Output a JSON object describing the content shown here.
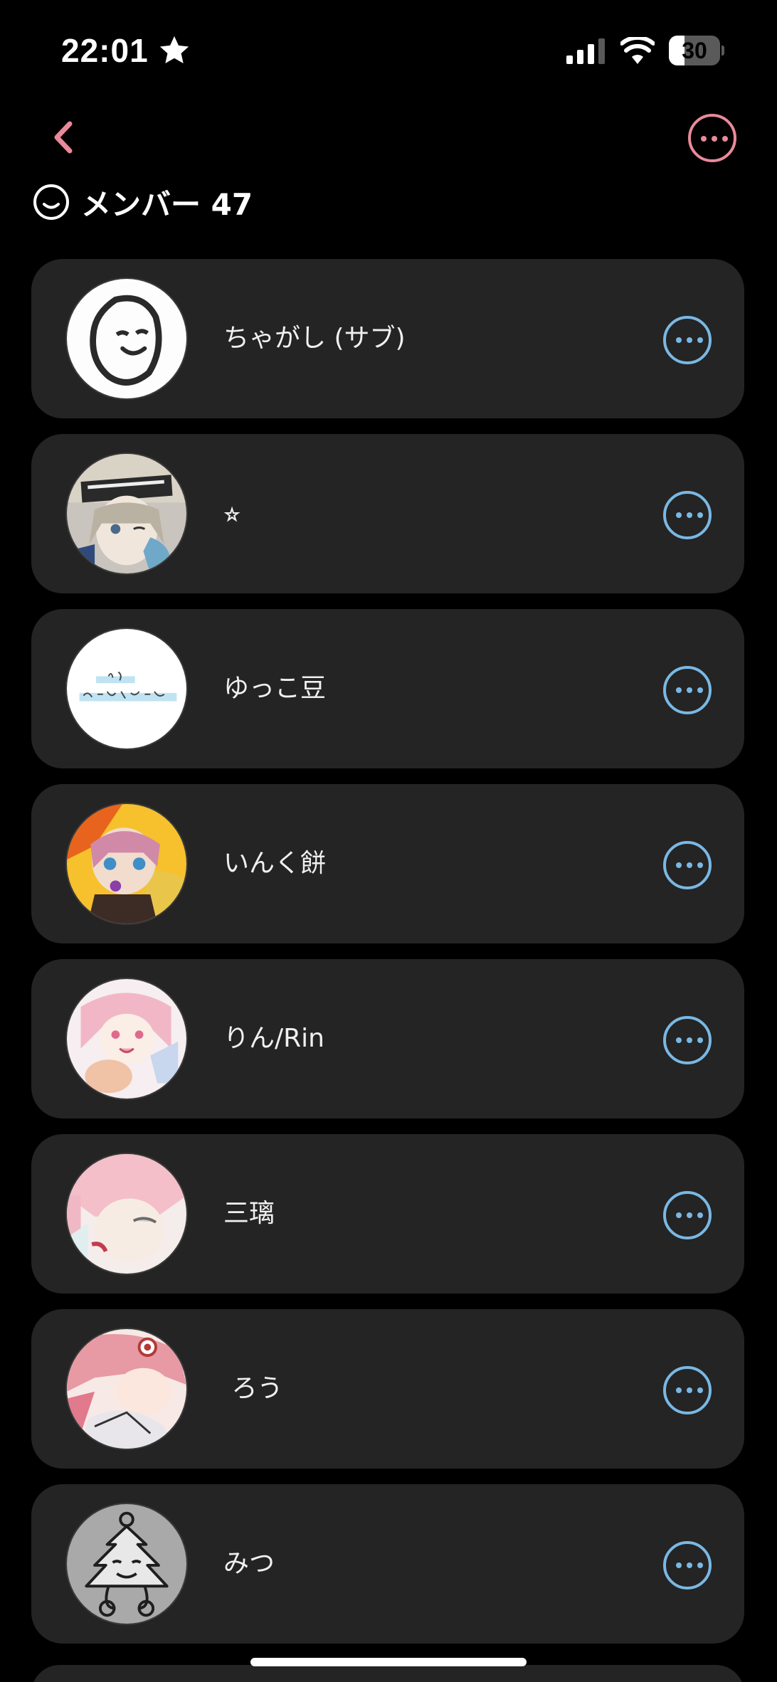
{
  "status_bar": {
    "time": "22:01",
    "battery": "30",
    "battery_level": 0.3
  },
  "header": {
    "title": "メンバー 47"
  },
  "colors": {
    "accent_pink": "#e88a9a",
    "accent_blue": "#7ab8e4",
    "card_bg": "#242424",
    "page_bg": "#000000"
  },
  "members": [
    {
      "name": "ちゃがし (サブ)",
      "avatar": "white-blob-face"
    },
    {
      "name": "⭐︎",
      "avatar": "anime-girl-striped-hat"
    },
    {
      "name": "ゆっこ豆",
      "avatar": "text-image-white"
    },
    {
      "name": "いんく餅",
      "avatar": "anime-character-orange"
    },
    {
      "name": "りん/Rin",
      "avatar": "anime-girl-pink-pastel"
    },
    {
      "name": "三璃",
      "avatar": "anime-girl-pink-hair"
    },
    {
      "name": " ろう",
      "avatar": "anime-pink-red-eye"
    },
    {
      "name": "みつ",
      "avatar": "gray-doodle-character"
    }
  ]
}
